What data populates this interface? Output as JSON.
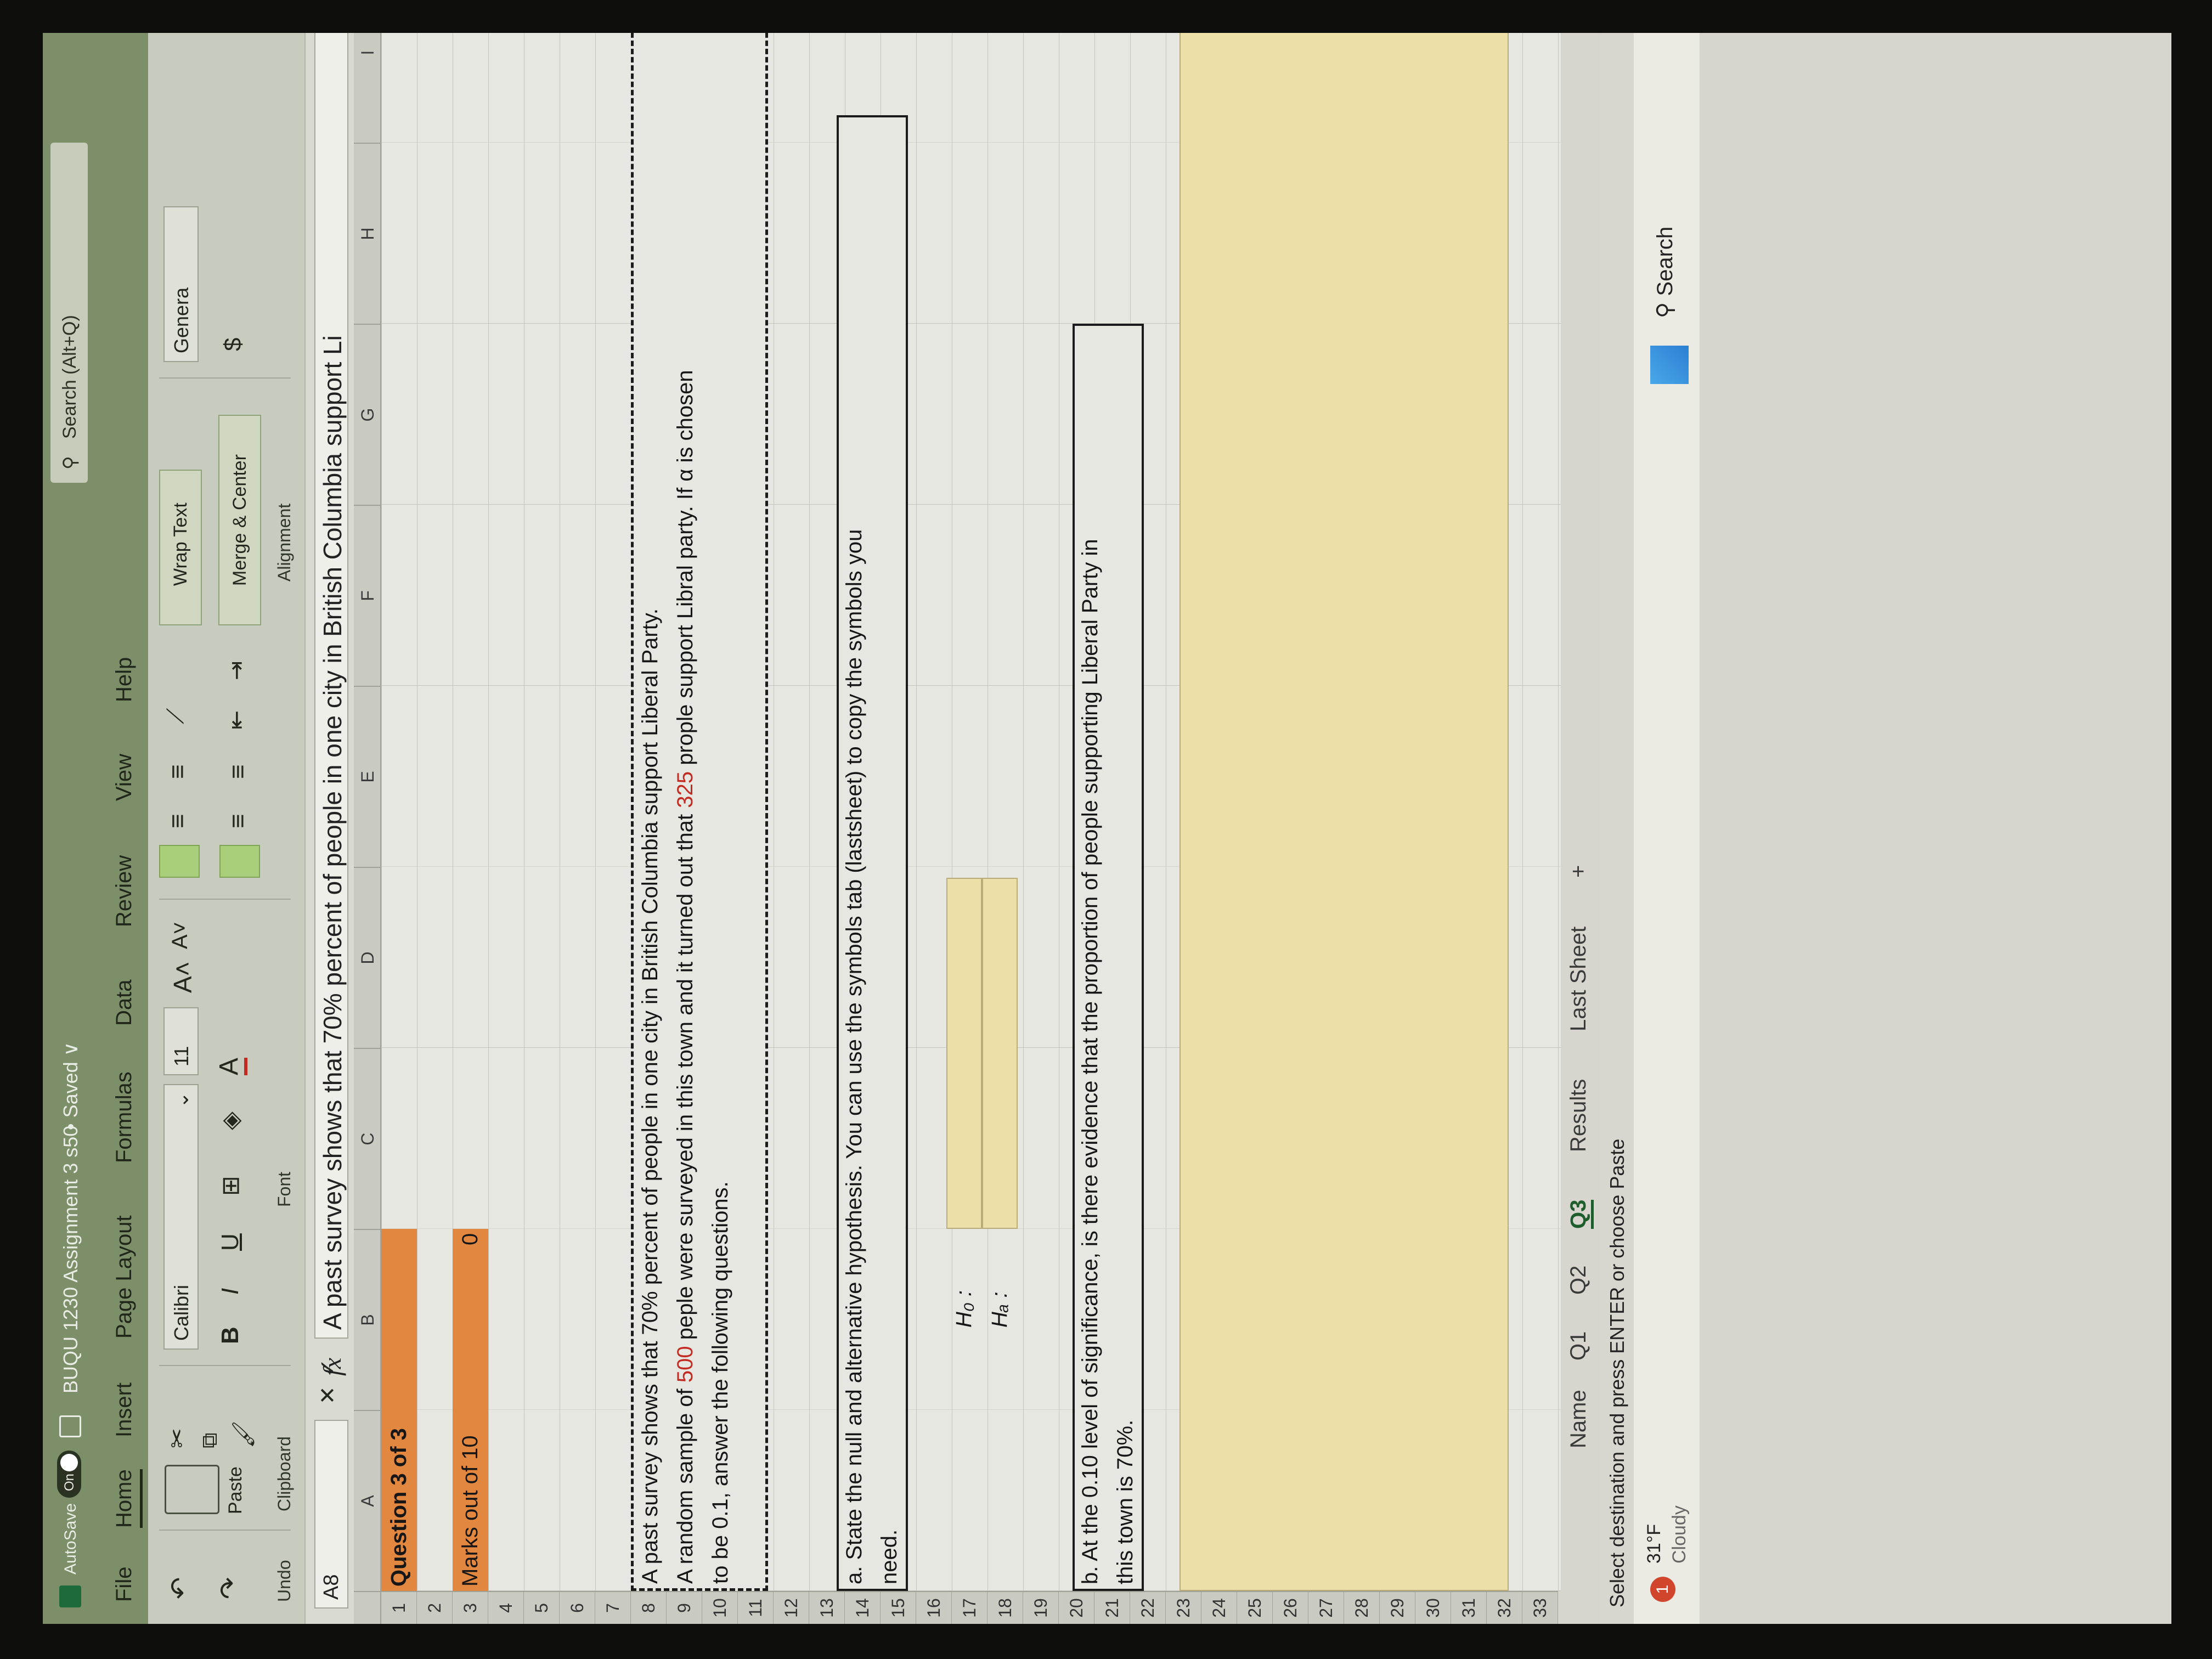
{
  "window": {
    "autosave_label": "AutoSave",
    "autosave_state": "On",
    "file_title": "BUQU 1230 Assignment 3 s50",
    "saved_status": "• Saved ∨",
    "search_placeholder": "Search (Alt+Q)"
  },
  "menu": {
    "file": "File",
    "home": "Home",
    "insert": "Insert",
    "page_layout": "Page Layout",
    "formulas": "Formulas",
    "data": "Data",
    "review": "Review",
    "view": "View",
    "help": "Help"
  },
  "ribbon": {
    "undo_group": "Undo",
    "paste_label": "Paste",
    "clipboard_group": "Clipboard",
    "font_name": "Calibri",
    "font_size": "11",
    "bold": "B",
    "italic": "I",
    "underline": "U",
    "increase_font": "A˄",
    "decrease_font": "A˅",
    "font_color": "A",
    "font_group": "Font",
    "wrap_text": "Wrap Text",
    "merge_center": "Merge & Center",
    "alignment_group": "Alignment",
    "number_format": "Genera",
    "currency": "$"
  },
  "formula_bar": {
    "name_box": "A8",
    "fx_label": "fx",
    "content": "A past survey shows that 70% percent of people in one city in British Columbia support Li"
  },
  "columns": [
    "A",
    "B",
    "C",
    "D",
    "E",
    "F",
    "G",
    "H",
    "I"
  ],
  "rows": [
    "1",
    "2",
    "3",
    "4",
    "5",
    "6",
    "7",
    "8",
    "9",
    "10",
    "11",
    "12",
    "13",
    "14",
    "15",
    "16",
    "17",
    "18",
    "19",
    "20",
    "21",
    "22",
    "23",
    "24",
    "25",
    "26",
    "27",
    "28",
    "29",
    "30",
    "31",
    "32",
    "33"
  ],
  "sheet": {
    "title": "Question 3 of 3",
    "marks_label": "Marks out of 10",
    "marks_value": "0",
    "q_line1": "A past survey shows that 70% percent of people in one city in British Columbia support Liberal Party.",
    "q_line2_a": "A random sample of ",
    "q_line2_n": "500",
    "q_line2_b": " peple were surveyed in this town and it turned out that ",
    "q_line2_x": "325",
    "q_line2_c": " prople support Libral party. If α is chosen",
    "q_line3": "to be 0.1, answer the following questions.",
    "a_line1": "a. State the null and alternative hypothesis. You can use the symbols tab (lastsheet) to copy the symbols you",
    "a_line2": "need.",
    "h0": "H₀ :",
    "ha": "Hₐ :",
    "b_line1": "b. At the 0.10 level of significance, is there evidence that the proportion of people supporting Liberal Party in",
    "b_line2": "this town is 70%."
  },
  "tabs": [
    "Name",
    "Q1",
    "Q2",
    "Q3",
    "Results",
    "Last Sheet",
    "+"
  ],
  "status_text": "Select destination and press ENTER or choose Paste",
  "taskbar": {
    "weather_badge": "1",
    "temperature": "31°F",
    "condition": "Cloudy",
    "search": "Search"
  },
  "colors": {
    "title_bar": "#7c8f68",
    "orange_header": "#e2873f",
    "answer_fill": "#ece0a8",
    "active_tab": "#1f5d2c",
    "highlight_number": "#c22a22"
  }
}
